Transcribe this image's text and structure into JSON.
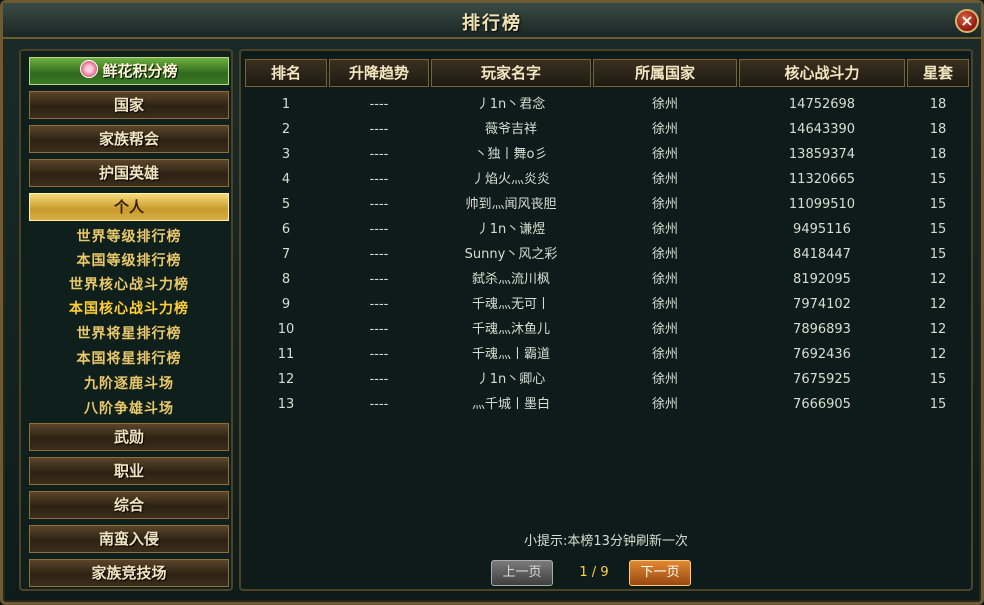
{
  "window": {
    "title": "排行榜",
    "close_label": "×"
  },
  "sidebar": {
    "buttons_top": [
      {
        "label": "鲜花积分榜",
        "style": "green"
      },
      {
        "label": "国家",
        "style": "normal"
      },
      {
        "label": "家族帮会",
        "style": "normal"
      },
      {
        "label": "护国英雄",
        "style": "normal"
      },
      {
        "label": "个人",
        "style": "gold"
      }
    ],
    "sub_items": [
      {
        "label": "世界等级排行榜",
        "active": false
      },
      {
        "label": "本国等级排行榜",
        "active": false
      },
      {
        "label": "世界核心战斗力榜",
        "active": false
      },
      {
        "label": "本国核心战斗力榜",
        "active": true
      },
      {
        "label": "世界将星排行榜",
        "active": false
      },
      {
        "label": "本国将星排行榜",
        "active": false
      },
      {
        "label": "九阶逐鹿斗场",
        "active": false
      },
      {
        "label": "八阶争雄斗场",
        "active": false
      }
    ],
    "buttons_bottom": [
      {
        "label": "武勋"
      },
      {
        "label": "职业"
      },
      {
        "label": "综合"
      },
      {
        "label": "南蛮入侵"
      },
      {
        "label": "家族竞技场"
      }
    ]
  },
  "table": {
    "headers": [
      "排名",
      "升降趋势",
      "玩家名字",
      "所属国家",
      "核心战斗力",
      "星套"
    ],
    "rows": [
      [
        "1",
        "----",
        "丿1n丶君念",
        "徐州",
        "14752698",
        "18"
      ],
      [
        "2",
        "----",
        "薇爷吉祥",
        "徐州",
        "14643390",
        "18"
      ],
      [
        "3",
        "----",
        "丶独丨舞o彡",
        "徐州",
        "13859374",
        "18"
      ],
      [
        "4",
        "----",
        "丿焰火灬炎炎",
        "徐州",
        "11320665",
        "15"
      ],
      [
        "5",
        "----",
        "帅到灬闻风丧胆",
        "徐州",
        "11099510",
        "15"
      ],
      [
        "6",
        "----",
        "丿1n丶谦煜",
        "徐州",
        "9495116",
        "15"
      ],
      [
        "7",
        "----",
        "Sunny丶风之彩",
        "徐州",
        "8418447",
        "15"
      ],
      [
        "8",
        "----",
        "弑杀灬流川枫",
        "徐州",
        "8192095",
        "12"
      ],
      [
        "9",
        "----",
        "千魂灬无可丨",
        "徐州",
        "7974102",
        "12"
      ],
      [
        "10",
        "----",
        "千魂灬沐鱼儿",
        "徐州",
        "7896893",
        "12"
      ],
      [
        "11",
        "----",
        "千魂灬丨霸道",
        "徐州",
        "7692436",
        "12"
      ],
      [
        "12",
        "----",
        "丿1n丶卿心",
        "徐州",
        "7675925",
        "15"
      ],
      [
        "13",
        "----",
        "灬千城丨墨白",
        "徐州",
        "7666905",
        "15"
      ]
    ]
  },
  "footer": {
    "tip": "小提示:本榜13分钟刷新一次",
    "prev_label": "上一页",
    "next_label": "下一页",
    "page_indicator": "1 / 9"
  }
}
